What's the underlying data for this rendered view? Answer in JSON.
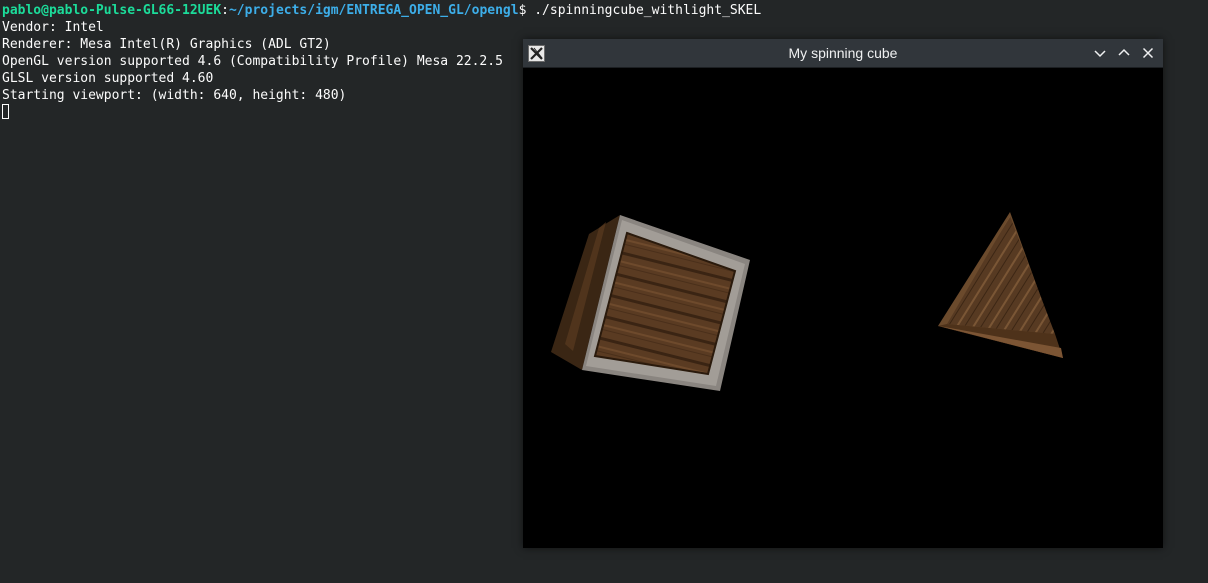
{
  "terminal": {
    "prompt_user": "pablo@pablo-Pulse-GL66-12UEK",
    "prompt_sep": ":",
    "prompt_path": "~/projects/igm/ENTREGA_OPEN_GL/opengl",
    "prompt_symbol": "$ ",
    "command": "./spinningcube_withlight_SKEL",
    "output_lines": [
      "Vendor: Intel",
      "Renderer: Mesa Intel(R) Graphics (ADL GT2)",
      "OpenGL version supported 4.6 (Compatibility Profile) Mesa 22.2.5",
      "GLSL version supported 4.60",
      "Starting viewport: (width: 640, height: 480)"
    ],
    "background": "#232627",
    "text_color": "#fcfcfc",
    "user_color": "#1cdc9a",
    "path_color": "#3daee9"
  },
  "gl_window": {
    "title": "My spinning cube",
    "app_icon": "x11-app-icon",
    "buttons": [
      "minimize-icon",
      "maximize-icon",
      "close-icon"
    ],
    "titlebar_color": "#31363b",
    "canvas_color": "#000000"
  }
}
